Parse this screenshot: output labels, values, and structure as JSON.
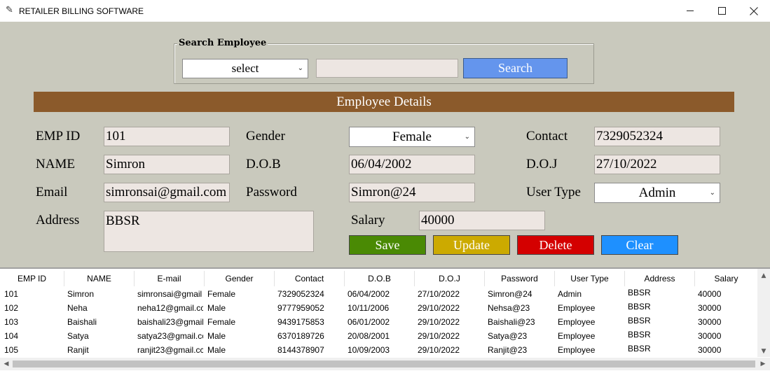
{
  "window": {
    "title": "RETAILER BILLING SOFTWARE",
    "icon": "feather-icon"
  },
  "search": {
    "legend": "Search Employee",
    "select_value": "select",
    "input_value": "",
    "button_label": "Search"
  },
  "section": {
    "title": "Employee Details"
  },
  "form": {
    "empid_label": "EMP ID",
    "empid_value": "101",
    "name_label": "NAME",
    "name_value": "Simron",
    "email_label": "Email",
    "email_value": "simronsai@gmail.com",
    "address_label": "Address",
    "address_value": "BBSR",
    "gender_label": "Gender",
    "gender_value": "Female",
    "dob_label": "D.O.B",
    "dob_value": "06/04/2002",
    "password_label": "Password",
    "password_value": "Simron@24",
    "contact_label": "Contact",
    "contact_value": "7329052324",
    "doj_label": "D.O.J",
    "doj_value": "27/10/2022",
    "usertype_label": "User Type",
    "usertype_value": "Admin",
    "salary_label": "Salary",
    "salary_value": "40000"
  },
  "buttons": {
    "save": "Save",
    "update": "Update",
    "delete": "Delete",
    "clear": "Clear"
  },
  "colors": {
    "background": "#c9c9bd",
    "header_brown": "#8b5a2b",
    "search_blue": "#6495ed",
    "save_green": "#4a8a04",
    "update_yellow": "#ccaa00",
    "delete_red": "#d40000",
    "clear_blue": "#1e90ff"
  },
  "table": {
    "columns": [
      "EMP ID",
      "NAME",
      "E-mail",
      "Gender",
      "Contact",
      "D.O.B",
      "D.O.J",
      "Password",
      "User Type",
      "Address",
      "Salary"
    ],
    "rows": [
      [
        "101",
        "Simron",
        "simronsai@gmail",
        "Female",
        "7329052324",
        "06/04/2002",
        "27/10/2022",
        "Simron@24",
        "Admin",
        "BBSR",
        "40000"
      ],
      [
        "102",
        "Neha",
        "neha12@gmail.cc",
        "Male",
        "9777959052",
        "10/11/2006",
        "29/10/2022",
        "Nehsa@23",
        "Employee",
        "BBSR",
        "30000"
      ],
      [
        "103",
        "Baishali",
        "baishali23@gmail",
        "Female",
        "9439175853",
        "06/01/2002",
        "29/10/2022",
        "Baishali@23",
        "Employee",
        "BBSR",
        "30000"
      ],
      [
        "104",
        "Satya",
        "satya23@gmail.cc",
        "Male",
        "6370189726",
        "20/08/2001",
        "29/10/2022",
        "Satya@23",
        "Employee",
        "BBSR",
        "30000"
      ],
      [
        "105",
        "Ranjit",
        "ranjit23@gmail.cc",
        "Male",
        "8144378907",
        "10/09/2003",
        "29/10/2022",
        "Ranjit@23",
        "Employee",
        "BBSR",
        "30000"
      ]
    ]
  }
}
